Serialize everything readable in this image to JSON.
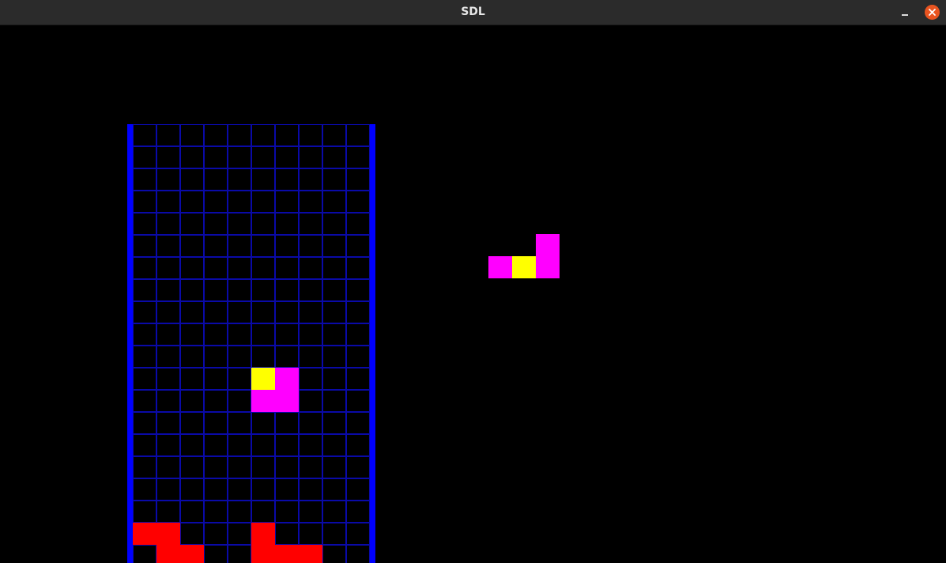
{
  "window": {
    "title": "SDL",
    "minimize_icon": "minimize-icon",
    "close_icon": "close-icon"
  },
  "colors": {
    "background": "#000000",
    "wall": "#0000ff",
    "grid_line": "#0a0aa8",
    "locked_block": "#ff0000",
    "piece_primary": "#ff00ff",
    "piece_pivot": "#ffff00",
    "close_button": "#e95420"
  },
  "board": {
    "columns": 10,
    "visible_rows": 20,
    "locked_cells": [
      {
        "col": 0,
        "row": 18
      },
      {
        "col": 1,
        "row": 18
      },
      {
        "col": 5,
        "row": 18
      },
      {
        "col": 1,
        "row": 19
      },
      {
        "col": 2,
        "row": 19
      },
      {
        "col": 5,
        "row": 19
      },
      {
        "col": 6,
        "row": 19
      },
      {
        "col": 7,
        "row": 19
      }
    ],
    "active_piece": {
      "cells": [
        {
          "col": 5,
          "row": 11,
          "color": "#ffff00"
        },
        {
          "col": 6,
          "row": 11,
          "color": "#ff00ff"
        },
        {
          "col": 5,
          "row": 12,
          "color": "#ff00ff"
        },
        {
          "col": 6,
          "row": 12,
          "color": "#ff00ff"
        }
      ]
    }
  },
  "next_piece": {
    "cells": [
      {
        "col": 2,
        "row": 0,
        "color": "#ff00ff"
      },
      {
        "col": 0,
        "row": 1,
        "color": "#ff00ff"
      },
      {
        "col": 1,
        "row": 1,
        "color": "#ffff00"
      },
      {
        "col": 2,
        "row": 1,
        "color": "#ff00ff"
      }
    ]
  }
}
